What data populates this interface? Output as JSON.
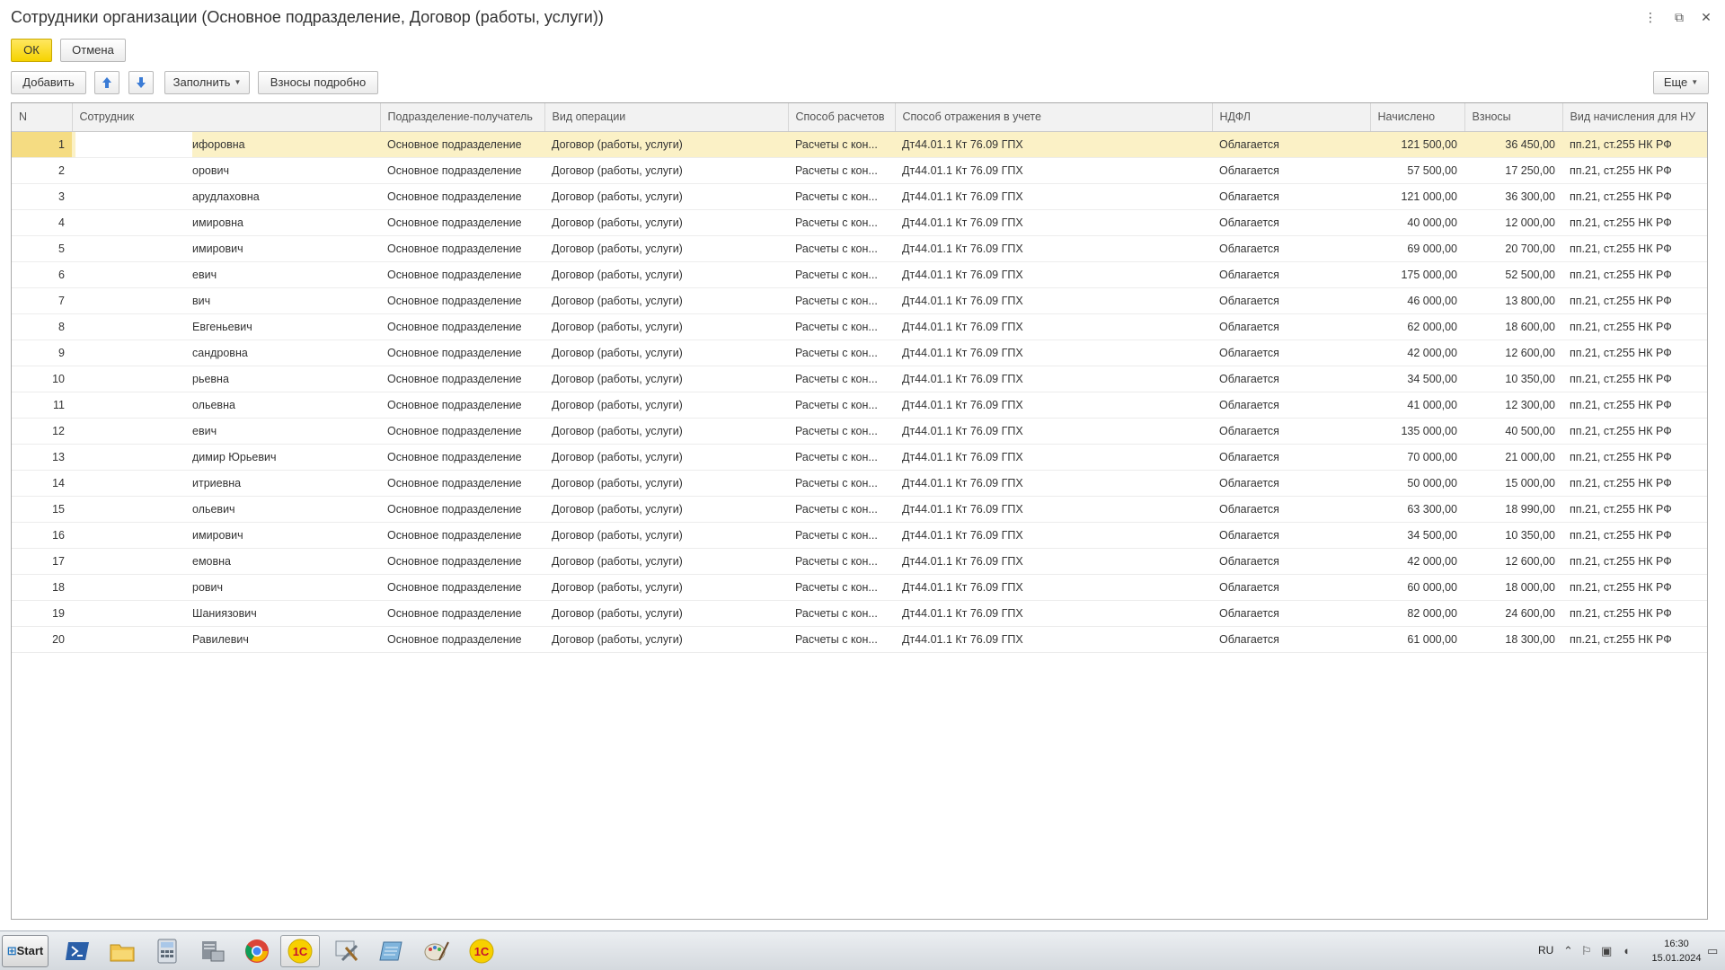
{
  "window": {
    "title": "Сотрудники организации (Основное подразделение, Договор (работы, услуги))",
    "controls": {
      "more": "⋮",
      "restore": "⧉",
      "close": "✕"
    }
  },
  "form_buttons": {
    "ok": "ОК",
    "cancel": "Отмена"
  },
  "toolbar": {
    "add": "Добавить",
    "move_up_icon": "arrow-up-icon",
    "move_down_icon": "arrow-down-icon",
    "fill": "Заполнить",
    "contributions_detail": "Взносы подробно",
    "more": "Еще"
  },
  "table": {
    "columns": [
      "N",
      "Сотрудник",
      "Подразделение-получатель",
      "Вид операции",
      "Способ расчетов",
      "Способ отражения в учете",
      "НДФЛ",
      "Начислено",
      "Взносы",
      "Вид начисления для НУ"
    ],
    "selected_row": 0,
    "rows": [
      {
        "n": "1",
        "employee": "ифоровна",
        "dept": "Основное подразделение",
        "operation": "Договор (работы, услуги)",
        "calc": "Расчеты с кон...",
        "account": "Дт44.01.1  Кт 76.09  ГПХ",
        "ndfl": "Облагается",
        "accrued": "121 500,00",
        "contrib": "36 450,00",
        "tax_type": "пп.21, ст.255 НК РФ"
      },
      {
        "n": "2",
        "employee": "орович",
        "dept": "Основное подразделение",
        "operation": "Договор (работы, услуги)",
        "calc": "Расчеты с кон...",
        "account": "Дт44.01.1  Кт 76.09  ГПХ",
        "ndfl": "Облагается",
        "accrued": "57 500,00",
        "contrib": "17 250,00",
        "tax_type": "пп.21, ст.255 НК РФ"
      },
      {
        "n": "3",
        "employee": "арудлаховна",
        "dept": "Основное подразделение",
        "operation": "Договор (работы, услуги)",
        "calc": "Расчеты с кон...",
        "account": "Дт44.01.1  Кт 76.09  ГПХ",
        "ndfl": "Облагается",
        "accrued": "121 000,00",
        "contrib": "36 300,00",
        "tax_type": "пп.21, ст.255 НК РФ"
      },
      {
        "n": "4",
        "employee": "имировна",
        "dept": "Основное подразделение",
        "operation": "Договор (работы, услуги)",
        "calc": "Расчеты с кон...",
        "account": "Дт44.01.1  Кт 76.09  ГПХ",
        "ndfl": "Облагается",
        "accrued": "40 000,00",
        "contrib": "12 000,00",
        "tax_type": "пп.21, ст.255 НК РФ"
      },
      {
        "n": "5",
        "employee": "имирович",
        "dept": "Основное подразделение",
        "operation": "Договор (работы, услуги)",
        "calc": "Расчеты с кон...",
        "account": "Дт44.01.1  Кт 76.09  ГПХ",
        "ndfl": "Облагается",
        "accrued": "69 000,00",
        "contrib": "20 700,00",
        "tax_type": "пп.21, ст.255 НК РФ"
      },
      {
        "n": "6",
        "employee": "евич",
        "dept": "Основное подразделение",
        "operation": "Договор (работы, услуги)",
        "calc": "Расчеты с кон...",
        "account": "Дт44.01.1  Кт 76.09  ГПХ",
        "ndfl": "Облагается",
        "accrued": "175 000,00",
        "contrib": "52 500,00",
        "tax_type": "пп.21, ст.255 НК РФ"
      },
      {
        "n": "7",
        "employee": "вич",
        "dept": "Основное подразделение",
        "operation": "Договор (работы, услуги)",
        "calc": "Расчеты с кон...",
        "account": "Дт44.01.1  Кт 76.09  ГПХ",
        "ndfl": "Облагается",
        "accrued": "46 000,00",
        "contrib": "13 800,00",
        "tax_type": "пп.21, ст.255 НК РФ"
      },
      {
        "n": "8",
        "employee": "Евгеньевич",
        "dept": "Основное подразделение",
        "operation": "Договор (работы, услуги)",
        "calc": "Расчеты с кон...",
        "account": "Дт44.01.1  Кт 76.09  ГПХ",
        "ndfl": "Облагается",
        "accrued": "62 000,00",
        "contrib": "18 600,00",
        "tax_type": "пп.21, ст.255 НК РФ"
      },
      {
        "n": "9",
        "employee": "сандровна",
        "dept": "Основное подразделение",
        "operation": "Договор (работы, услуги)",
        "calc": "Расчеты с кон...",
        "account": "Дт44.01.1  Кт 76.09  ГПХ",
        "ndfl": "Облагается",
        "accrued": "42 000,00",
        "contrib": "12 600,00",
        "tax_type": "пп.21, ст.255 НК РФ"
      },
      {
        "n": "10",
        "employee": "рьевна",
        "dept": "Основное подразделение",
        "operation": "Договор (работы, услуги)",
        "calc": "Расчеты с кон...",
        "account": "Дт44.01.1  Кт 76.09  ГПХ",
        "ndfl": "Облагается",
        "accrued": "34 500,00",
        "contrib": "10 350,00",
        "tax_type": "пп.21, ст.255 НК РФ"
      },
      {
        "n": "11",
        "employee": "ольевна",
        "dept": "Основное подразделение",
        "operation": "Договор (работы, услуги)",
        "calc": "Расчеты с кон...",
        "account": "Дт44.01.1  Кт 76.09  ГПХ",
        "ndfl": "Облагается",
        "accrued": "41 000,00",
        "contrib": "12 300,00",
        "tax_type": "пп.21, ст.255 НК РФ"
      },
      {
        "n": "12",
        "employee": "евич",
        "dept": "Основное подразделение",
        "operation": "Договор (работы, услуги)",
        "calc": "Расчеты с кон...",
        "account": "Дт44.01.1  Кт 76.09  ГПХ",
        "ndfl": "Облагается",
        "accrued": "135 000,00",
        "contrib": "40 500,00",
        "tax_type": "пп.21, ст.255 НК РФ"
      },
      {
        "n": "13",
        "employee": "димир Юрьевич",
        "dept": "Основное подразделение",
        "operation": "Договор (работы, услуги)",
        "calc": "Расчеты с кон...",
        "account": "Дт44.01.1  Кт 76.09  ГПХ",
        "ndfl": "Облагается",
        "accrued": "70 000,00",
        "contrib": "21 000,00",
        "tax_type": "пп.21, ст.255 НК РФ"
      },
      {
        "n": "14",
        "employee": "итриевна",
        "dept": "Основное подразделение",
        "operation": "Договор (работы, услуги)",
        "calc": "Расчеты с кон...",
        "account": "Дт44.01.1  Кт 76.09  ГПХ",
        "ndfl": "Облагается",
        "accrued": "50 000,00",
        "contrib": "15 000,00",
        "tax_type": "пп.21, ст.255 НК РФ"
      },
      {
        "n": "15",
        "employee": "ольевич",
        "dept": "Основное подразделение",
        "operation": "Договор (работы, услуги)",
        "calc": "Расчеты с кон...",
        "account": "Дт44.01.1  Кт 76.09  ГПХ",
        "ndfl": "Облагается",
        "accrued": "63 300,00",
        "contrib": "18 990,00",
        "tax_type": "пп.21, ст.255 НК РФ"
      },
      {
        "n": "16",
        "employee": "имирович",
        "dept": "Основное подразделение",
        "operation": "Договор (работы, услуги)",
        "calc": "Расчеты с кон...",
        "account": "Дт44.01.1  Кт 76.09  ГПХ",
        "ndfl": "Облагается",
        "accrued": "34 500,00",
        "contrib": "10 350,00",
        "tax_type": "пп.21, ст.255 НК РФ"
      },
      {
        "n": "17",
        "employee": "емовна",
        "dept": "Основное подразделение",
        "operation": "Договор (работы, услуги)",
        "calc": "Расчеты с кон...",
        "account": "Дт44.01.1  Кт 76.09  ГПХ",
        "ndfl": "Облагается",
        "accrued": "42 000,00",
        "contrib": "12 600,00",
        "tax_type": "пп.21, ст.255 НК РФ"
      },
      {
        "n": "18",
        "employee": "рович",
        "dept": "Основное подразделение",
        "operation": "Договор (работы, услуги)",
        "calc": "Расчеты с кон...",
        "account": "Дт44.01.1  Кт 76.09  ГПХ",
        "ndfl": "Облагается",
        "accrued": "60 000,00",
        "contrib": "18 000,00",
        "tax_type": "пп.21, ст.255 НК РФ"
      },
      {
        "n": "19",
        "employee": "Шаниязович",
        "dept": "Основное подразделение",
        "operation": "Договор (работы, услуги)",
        "calc": "Расчеты с кон...",
        "account": "Дт44.01.1  Кт 76.09  ГПХ",
        "ndfl": "Облагается",
        "accrued": "82 000,00",
        "contrib": "24 600,00",
        "tax_type": "пп.21, ст.255 НК РФ"
      },
      {
        "n": "20",
        "employee": "Равилевич",
        "dept": "Основное подразделение",
        "operation": "Договор (работы, услуги)",
        "calc": "Расчеты с кон...",
        "account": "Дт44.01.1  Кт 76.09  ГПХ",
        "ndfl": "Облагается",
        "accrued": "61 000,00",
        "contrib": "18 300,00",
        "tax_type": "пп.21, ст.255 НК РФ"
      }
    ]
  },
  "taskbar": {
    "start": "Start",
    "apps": [
      "powershell-icon",
      "file-explorer-icon",
      "calculator-icon",
      "server-manager-icon",
      "chrome-icon",
      "1c-active-icon",
      "tools-icon",
      "notepad-icon",
      "paint-icon",
      "1c-icon"
    ],
    "language": "RU",
    "time": "16:30",
    "date": "15.01.2024"
  },
  "colors": {
    "accent_yellow": "#f6d300",
    "selected_row": "#fbf1c6",
    "selected_cell": "#f5dc82",
    "header_bg": "#f2f2f2"
  }
}
